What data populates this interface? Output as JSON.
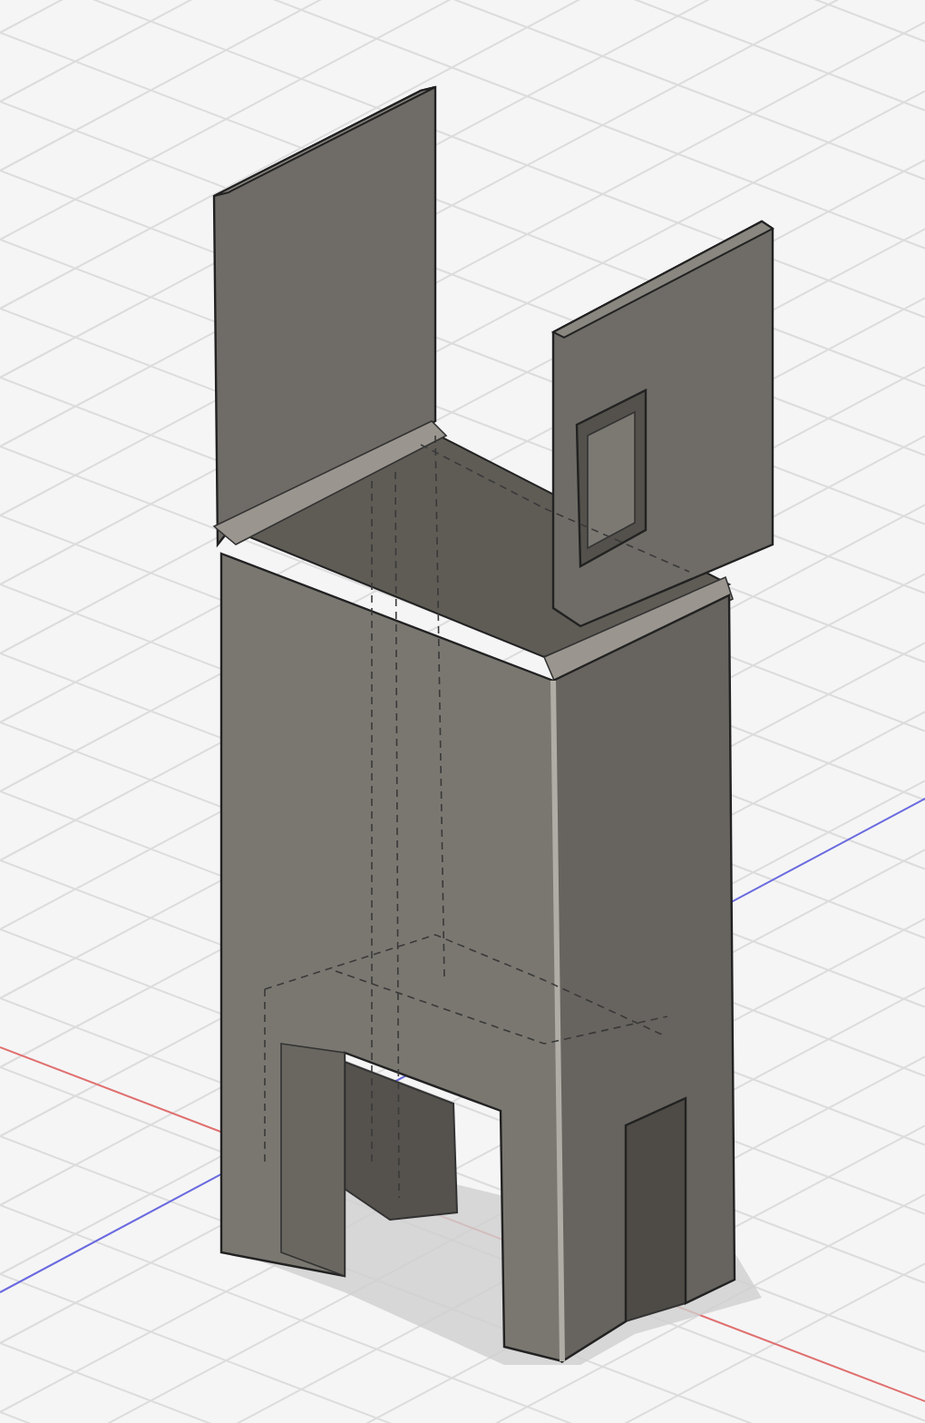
{
  "viewport": {
    "grid": true
  },
  "axes": [
    {
      "kind": "x",
      "color": "#e07070"
    },
    {
      "kind": "z",
      "color": "#6a6ae0"
    }
  ],
  "model": {
    "kind": "bracket"
  }
}
